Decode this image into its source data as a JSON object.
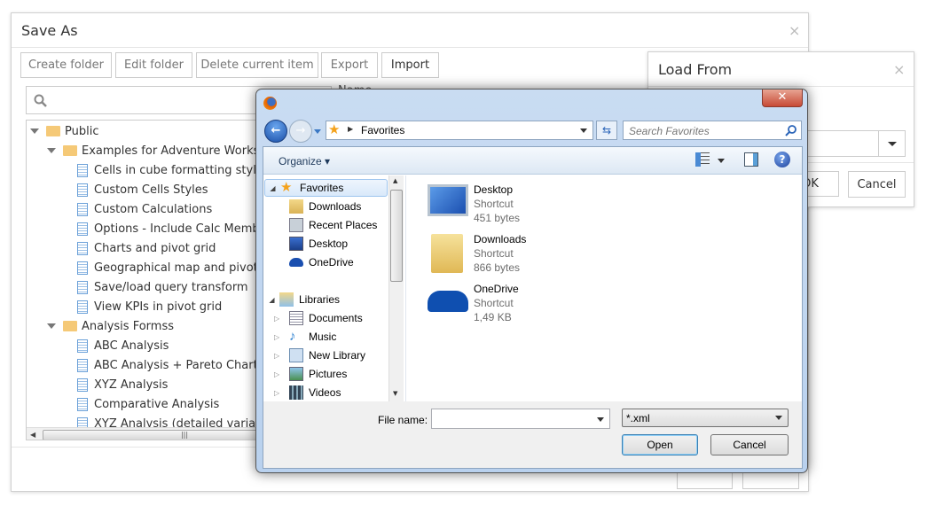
{
  "save_as": {
    "title": "Save As",
    "toolbar": [
      "Create folder",
      "Edit folder",
      "Delete current item",
      "Export",
      "Import"
    ],
    "column_header": "Name",
    "tree": [
      {
        "label": "Public",
        "level": 0,
        "type": "folder"
      },
      {
        "label": "Examples for Adventure Works dat",
        "level": 1,
        "type": "folder"
      },
      {
        "label": "Cells in cube formatting styles",
        "level": 2,
        "type": "doc"
      },
      {
        "label": "Custom Cells Styles",
        "level": 2,
        "type": "doc"
      },
      {
        "label": "Custom Calculations",
        "level": 2,
        "type": "doc"
      },
      {
        "label": "Options - Include Calc Member",
        "level": 2,
        "type": "doc"
      },
      {
        "label": "Charts and pivot grid",
        "level": 2,
        "type": "doc"
      },
      {
        "label": "Geographical map and pivot gr",
        "level": 2,
        "type": "doc"
      },
      {
        "label": "Save/load query transform",
        "level": 2,
        "type": "doc"
      },
      {
        "label": "View KPIs in pivot grid",
        "level": 2,
        "type": "doc"
      },
      {
        "label": "Analysis Formss",
        "level": 1,
        "type": "folder"
      },
      {
        "label": "ABC Analysis",
        "level": 2,
        "type": "doc"
      },
      {
        "label": "ABC Analysis + Pareto Chart",
        "level": 2,
        "type": "doc"
      },
      {
        "label": "XYZ Analysis",
        "level": 2,
        "type": "doc"
      },
      {
        "label": "Comparative Analysis",
        "level": 2,
        "type": "doc"
      },
      {
        "label": "XYZ Analysis (detailed variance)",
        "level": 2,
        "type": "doc"
      }
    ]
  },
  "load_from": {
    "title": "Load From",
    "ok": "OK",
    "cancel": "Cancel"
  },
  "file_dialog": {
    "breadcrumb": "Favorites",
    "search_placeholder": "Search Favorites",
    "organize": "Organize",
    "nav": [
      {
        "label": "Favorites",
        "icon": "star-icon",
        "level": 0,
        "selected": true
      },
      {
        "label": "Downloads",
        "icon": "downloads-folder-icon",
        "level": 1
      },
      {
        "label": "Recent Places",
        "icon": "recent-places-icon",
        "level": 1
      },
      {
        "label": "Desktop",
        "icon": "desktop-icon",
        "level": 1
      },
      {
        "label": "OneDrive",
        "icon": "onedrive-icon",
        "level": 1
      },
      {
        "label": "Libraries",
        "icon": "libraries-icon",
        "level": 0
      },
      {
        "label": "Documents",
        "icon": "documents-icon",
        "level": 1
      },
      {
        "label": "Music",
        "icon": "music-icon",
        "level": 1
      },
      {
        "label": "New Library",
        "icon": "library-icon",
        "level": 1
      },
      {
        "label": "Pictures",
        "icon": "pictures-icon",
        "level": 1
      },
      {
        "label": "Videos",
        "icon": "videos-icon",
        "level": 1
      }
    ],
    "files": [
      {
        "name": "Desktop",
        "type": "Shortcut",
        "size": "451 bytes",
        "icon": "desktop-icon"
      },
      {
        "name": "Downloads",
        "type": "Shortcut",
        "size": "866 bytes",
        "icon": "downloads-folder-icon"
      },
      {
        "name": "OneDrive",
        "type": "Shortcut",
        "size": "1,49 KB",
        "icon": "onedrive-icon"
      }
    ],
    "file_name_label": "File name:",
    "file_name_value": "",
    "file_type": "*.xml",
    "open": "Open",
    "cancel": "Cancel"
  }
}
